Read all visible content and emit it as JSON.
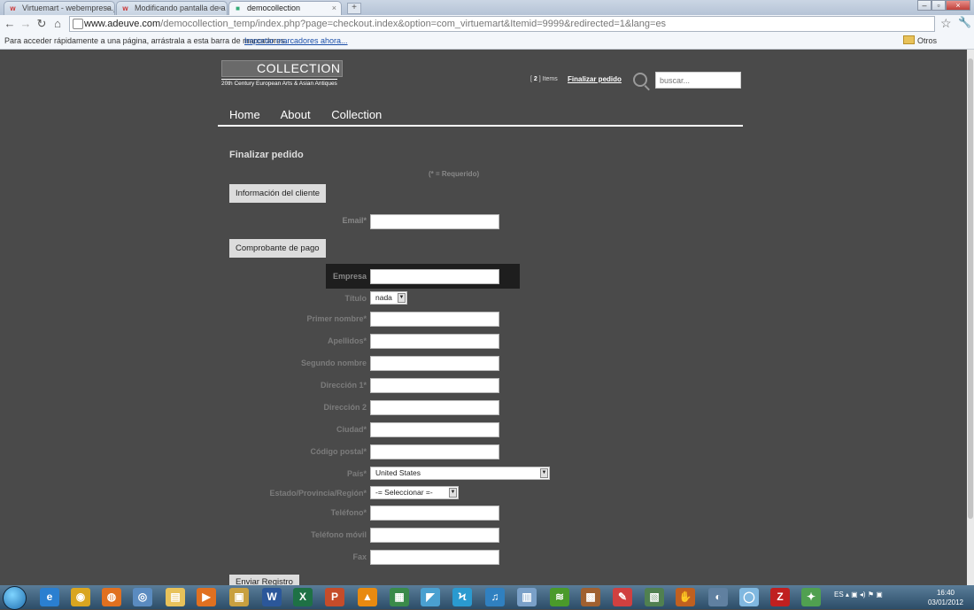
{
  "browser": {
    "tabs": [
      {
        "title": "Virtuemart - webempresa.jo",
        "active": false
      },
      {
        "title": "Modificando pantalla de a",
        "active": false
      },
      {
        "title": "democollection",
        "active": true
      }
    ],
    "address": {
      "domain": "www.adeuve.com",
      "path": "/democollection_temp/index.php?page=checkout.index&option=com_virtuemart&Itemid=9999&redirected=1&lang=es"
    },
    "bookmarks_hint": "Para acceder rápidamente a una página, arrástrala a esta barra de marcadores.",
    "bookmarks_import": "Importar marcadores ahora...",
    "bookmarks_other": "Otros marcadores"
  },
  "header": {
    "logo_word": "COLLECTION",
    "logo_sub": "20th Century European Arts & Asian Antiques",
    "cart_count": "2",
    "cart_items": "Items",
    "checkout_link": "Finalizar pedido",
    "search_placeholder": "buscar..."
  },
  "nav": {
    "items": [
      "Home",
      "About",
      "Collection"
    ]
  },
  "form": {
    "title": "Finalizar pedido",
    "required_note": "(* = Requerido)",
    "section_customer": "Información del cliente",
    "email_label": "Email*",
    "section_billing": "Comprobante de pago",
    "company_label": "Empresa",
    "title_label": "Título",
    "title_value": "nada",
    "fields": [
      {
        "label": "Primer nombre*"
      },
      {
        "label": "Apellidos*"
      },
      {
        "label": "Segundo nombre"
      },
      {
        "label": "Dirección 1*"
      },
      {
        "label": "Dirección 2"
      },
      {
        "label": "Ciudad*"
      },
      {
        "label": "Código postal*"
      }
    ],
    "country_label": "País*",
    "country_value": "United States",
    "state_label": "Estado/Provincia/Región*",
    "state_value": "-= Seleccionar =-",
    "phone_label": "Teléfono*",
    "mobile_label": "Teléfono móvil",
    "fax_label": "Fax",
    "submit_label": "Enviar Registro"
  },
  "taskbar": {
    "lang": "ES",
    "time": "16:40",
    "date": "03/01/2012"
  },
  "colors": {
    "page_bg": "#4a4a4a",
    "button_bg": "#dcdcdc"
  }
}
